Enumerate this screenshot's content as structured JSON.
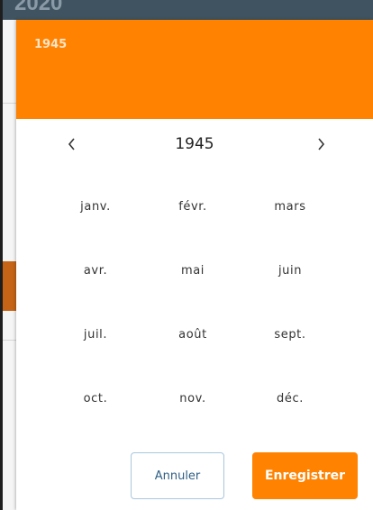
{
  "background": {
    "year_partial": "2020"
  },
  "dialog": {
    "header_year": "1945",
    "nav": {
      "year": "1945"
    },
    "months": [
      "janv.",
      "févr.",
      "mars",
      "avr.",
      "mai",
      "juin",
      "juil.",
      "août",
      "sept.",
      "oct.",
      "nov.",
      "déc."
    ],
    "buttons": {
      "cancel": "Annuler",
      "save": "Enregistrer"
    }
  },
  "colors": {
    "accent": "#ff8200",
    "header_text": "#ffe4c6",
    "cancel_border": "#a9c7dd",
    "cancel_text": "#2f5f85"
  },
  "icons": {
    "prev": "chevron-left-icon",
    "next": "chevron-right-icon"
  }
}
